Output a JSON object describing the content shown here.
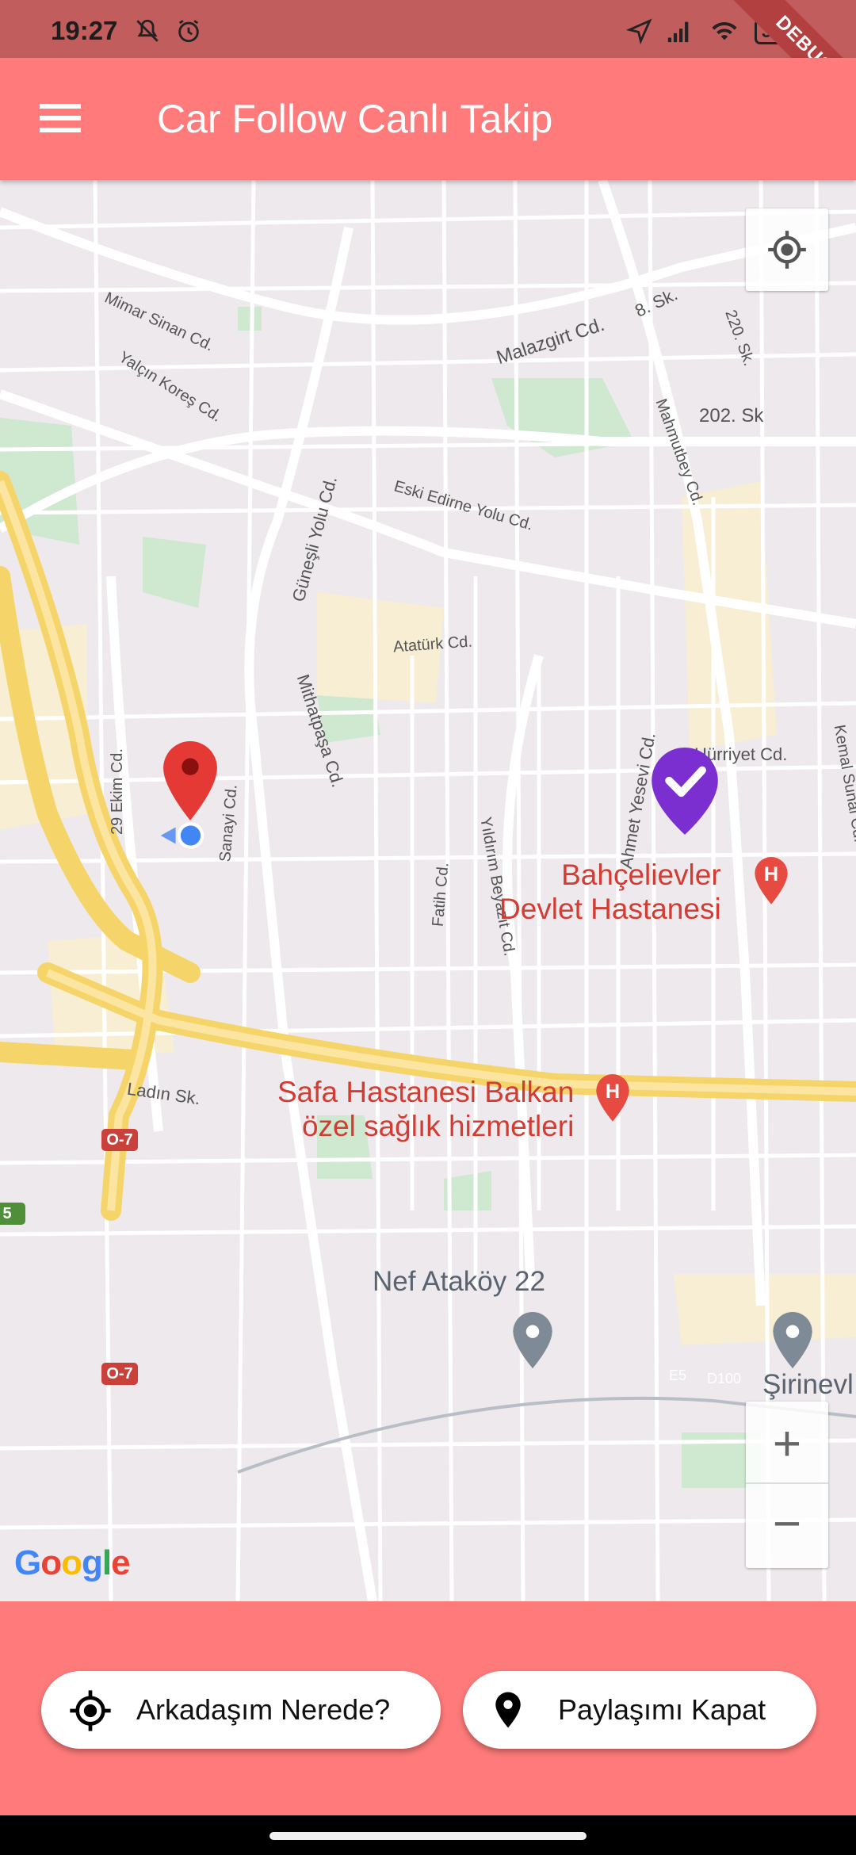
{
  "status_bar": {
    "time": "19:27",
    "battery": "38",
    "debug_banner": "DEBUG"
  },
  "app_bar": {
    "title": "Car Follow Canlı Takip",
    "menu_icon": "menu-icon"
  },
  "map": {
    "streets": [
      "Mimar Sinan Cd.",
      "Yalçın Koreş Cd.",
      "Malazgirt Cd.",
      "8. Sk.",
      "220. Sk.",
      "202. Sk",
      "Mahmutbey Cd.",
      "Eski Edirne Yolu Cd.",
      "Güneşli Yolu Cd.",
      "Atatürk Cd.",
      "Mithatpaşa Cd.",
      "29 Ekim Cd.",
      "Sanayi Cd.",
      "Hürriyet Cd.",
      "Kemal Sunal Cd.",
      "Ahmet Yesevi Cd.",
      "Yıldırım Beyazıt Cd.",
      "Fatih Cd.",
      "Ladın Sk.",
      "E5",
      "D100"
    ],
    "pois": {
      "hospital1_line1": "Bahçelievler",
      "hospital1_line2": "Devlet Hastanesi",
      "hospital2_line1": "Safa Hastanesi Balkan",
      "hospital2_line2": "özel sağlık hizmetleri",
      "place": "Nef Ataköy 22",
      "district": "Şirinevl"
    },
    "road_shields": [
      "O-7",
      "O-7",
      "5"
    ],
    "google_logo": "Google",
    "zoom_in": "+",
    "zoom_out": "−"
  },
  "actions": {
    "find_friend_label": "Arkadaşım Nerede?",
    "stop_sharing_label": "Paylaşımı Kapat"
  },
  "colors": {
    "accent": "#ff7b7b",
    "status_bar": "#c25d5d",
    "marker_red": "#e53935",
    "marker_purple": "#7b2fd0"
  }
}
